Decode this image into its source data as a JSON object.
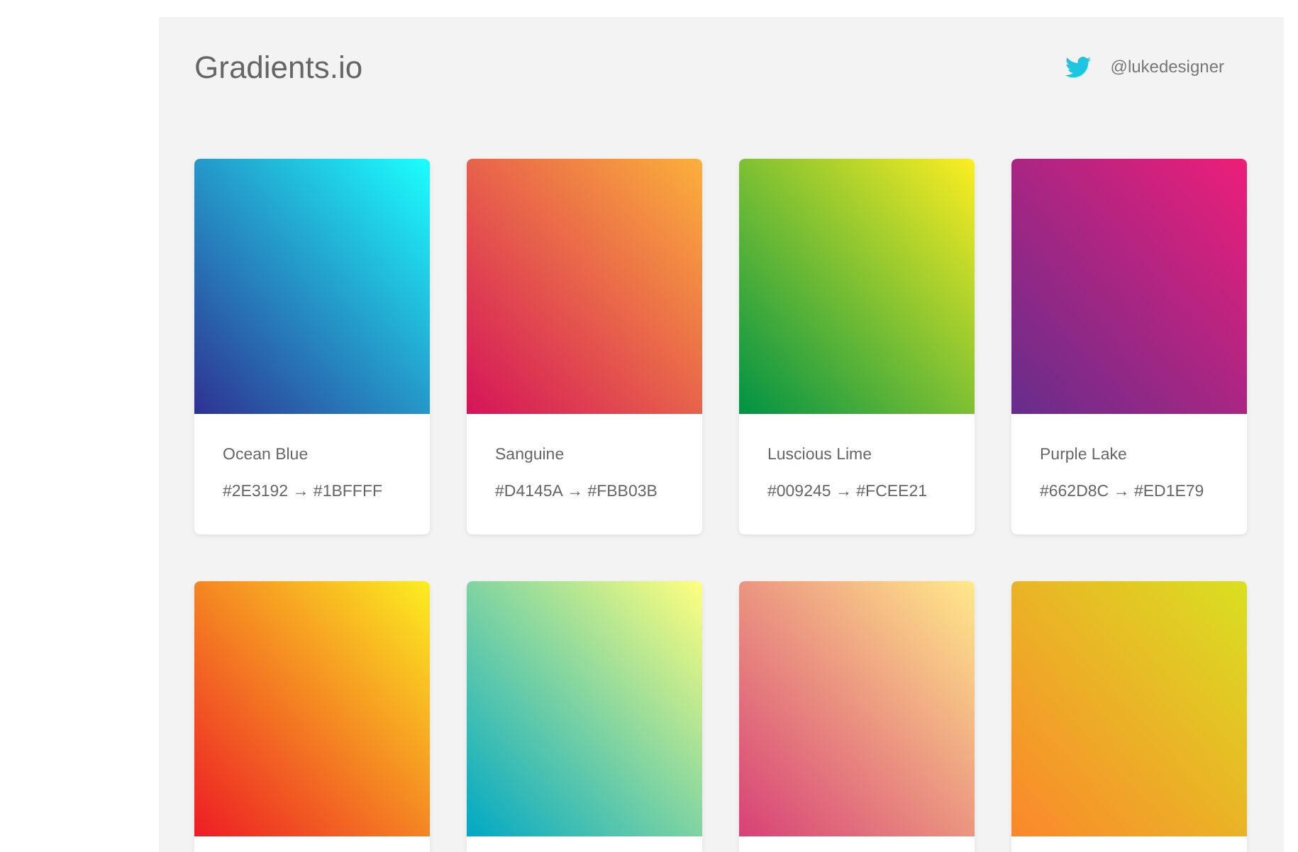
{
  "header": {
    "title": "Gradients.io",
    "twitter_handle": "@lukedesigner"
  },
  "gradients": [
    {
      "name": "Ocean Blue",
      "codes": "#2E3192 → #1BFFFF",
      "stops": [
        {
          "color": "#2e3192"
        },
        {
          "color": "#1bffff"
        }
      ]
    },
    {
      "name": "Sanguine",
      "codes": "#D4145A → #FBB03B",
      "stops": [
        {
          "color": "#d4145a"
        },
        {
          "color": "#fbb03b"
        }
      ]
    },
    {
      "name": "Luscious Lime",
      "codes": "#009245 → #FCEE21",
      "stops": [
        {
          "color": "#009245"
        },
        {
          "color": "#fcee21"
        }
      ]
    },
    {
      "name": "Purple Lake",
      "codes": "#662D8C → #ED1E79",
      "stops": [
        {
          "color": "#662d8c"
        },
        {
          "color": "#ed1e79"
        }
      ]
    },
    {
      "stops": [
        {
          "color": "#ed1c24"
        },
        {
          "color": "#fcee21"
        }
      ]
    },
    {
      "stops": [
        {
          "color": "#00a8c5"
        },
        {
          "color": "#ffff7e"
        }
      ]
    },
    {
      "stops": [
        {
          "color": "#d74177"
        },
        {
          "color": "#ffe98a"
        }
      ]
    },
    {
      "stops": [
        {
          "color": "#fb872b"
        },
        {
          "color": "#d9e021"
        }
      ]
    }
  ]
}
